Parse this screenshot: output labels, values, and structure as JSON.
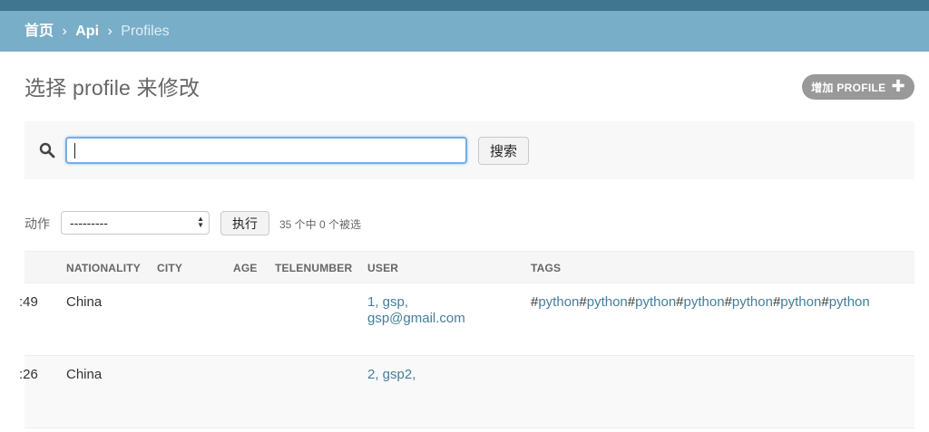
{
  "breadcrumbs": {
    "home": "首页",
    "app": "Api",
    "current": "Profiles",
    "separator": "›"
  },
  "page": {
    "title": "选择 profile 来修改",
    "add_button_label": "增加 PROFILE",
    "add_button_icon": "plus-icon"
  },
  "search": {
    "value": "",
    "placeholder": "",
    "button_label": "搜索",
    "icon": "search-icon"
  },
  "actions": {
    "label": "动作",
    "selected": "---------",
    "go_label": "执行",
    "counter": "35 个中 0 个被选"
  },
  "table": {
    "headers": {
      "nationality": "NATIONALITY",
      "city": "CITY",
      "age": "AGE",
      "telenumber": "TELENUMBER",
      "user": "USER",
      "tags": "TAGS"
    },
    "rows": [
      {
        "time_fragment": ":49",
        "nationality": "China",
        "city": "",
        "age": "",
        "telenumber": "",
        "user_line1": "1, gsp,",
        "user_line2": "gsp@gmail.com",
        "tags": [
          "python",
          "python",
          "python",
          "python",
          "python",
          "python",
          "python"
        ]
      },
      {
        "time_fragment": ":26",
        "nationality": "China",
        "city": "",
        "age": "",
        "telenumber": "",
        "user_line1": "2, gsp2,",
        "user_line2": "",
        "tags": []
      }
    ]
  },
  "colors": {
    "header_dark": "#417690",
    "breadcrumb_bg": "#79aec8",
    "link": "#447e9b",
    "add_button_bg": "#999999"
  }
}
